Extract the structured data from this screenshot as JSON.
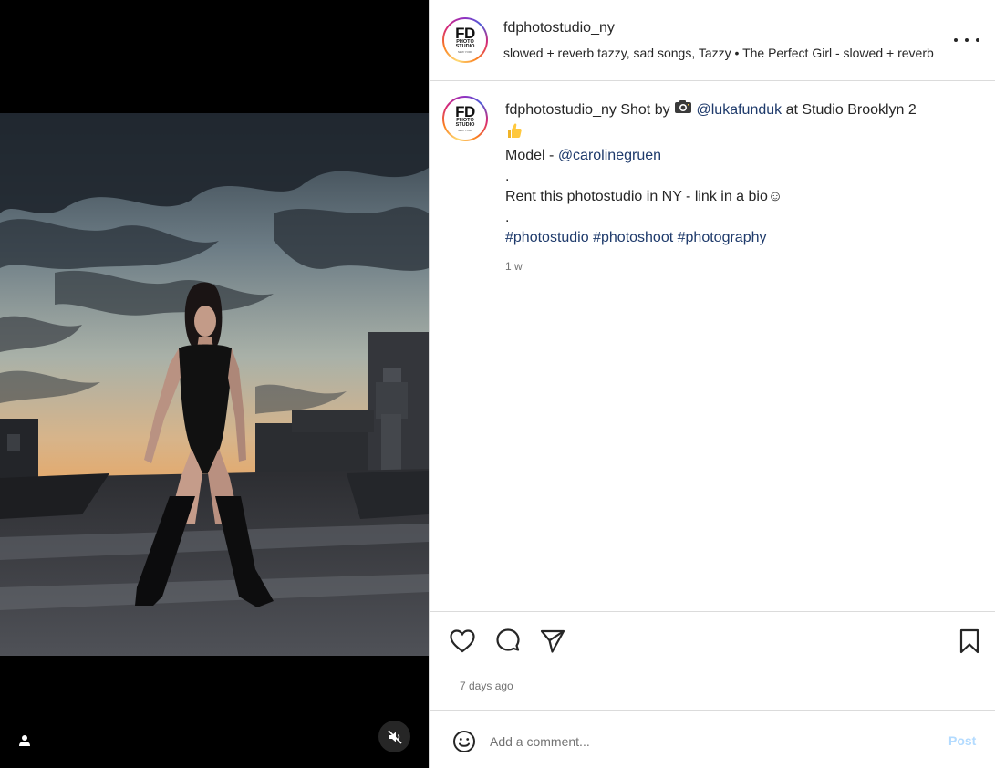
{
  "post": {
    "username": "fdphotostudio_ny",
    "audio": "slowed + reverb tazzy, sad songs, Tazzy • The Perfect Girl - slowed + reverb",
    "logo": {
      "main": "FD",
      "line1": "PHOTO",
      "line2": "STUDIO",
      "tiny": "NEW YORK"
    }
  },
  "caption": {
    "username": "fdphotostudio_ny",
    "shot_by": "Shot by",
    "camera_emoji": "📷",
    "photographer": "@lukafunduk",
    "location": "at Studio Brooklyn 2",
    "thumbs_emoji": "👍",
    "model_label": "Model -",
    "model": "@carolinegruen",
    "dot1": ".",
    "rent_text": "Rent this photostudio in NY - link in a bio",
    "smile": "☺",
    "dot2": ".",
    "hashtags": [
      "#photostudio",
      "#photoshoot",
      "#photography"
    ],
    "time": "1 w"
  },
  "actions": {
    "like": "heart-icon",
    "comment": "comment-icon",
    "share": "share-icon",
    "save": "bookmark-icon"
  },
  "days_ago": "7 days ago",
  "comment_box": {
    "placeholder": "Add a comment...",
    "post_label": "Post"
  },
  "colors": {
    "link": "#1e3a6b",
    "post_disabled": "#b3dbff",
    "muted_text": "#737373",
    "divider": "#dbdbdb"
  }
}
